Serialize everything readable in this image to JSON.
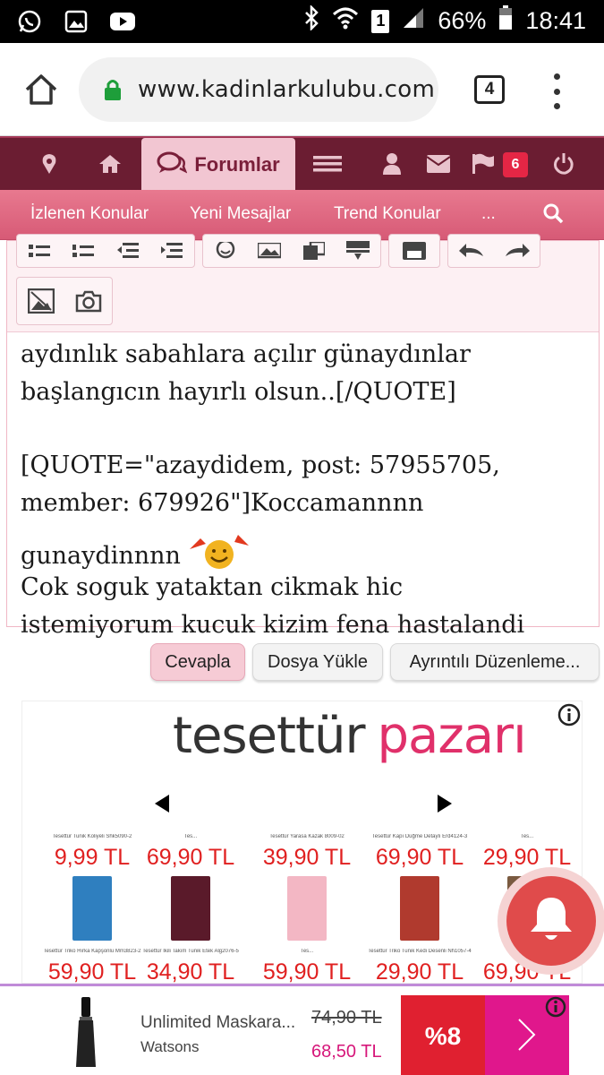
{
  "status_bar": {
    "battery": "66%",
    "time": "18:41",
    "sim": "1",
    "icons": [
      "whatsapp-icon",
      "gallery-icon",
      "youtube-icon",
      "bluetooth-icon",
      "wifi-icon",
      "signal-icon",
      "battery-icon"
    ]
  },
  "browser": {
    "url": "www.kadinlarkulubu.com",
    "tab_count": "4"
  },
  "site_nav": {
    "active_label": "Forumlar",
    "badge_count": "6",
    "icons": [
      "location-pin-icon",
      "home-icon",
      "forum-chat-icon",
      "hamburger-menu-icon",
      "user-icon",
      "envelope-icon",
      "flag-icon",
      "power-icon"
    ]
  },
  "sub_nav": {
    "items": [
      "İzlenen Konular",
      "Yeni Mesajlar",
      "Trend Konular",
      "..."
    ]
  },
  "editor": {
    "lines": [
      "aydınlık sabahlara açılır günaydınlar",
      "başlangıcın hayırlı olsun..[/QUOTE]",
      "[QUOTE=\"azaydidem, post: 57955705,",
      "member: 679926\"]Koccamannnn",
      "gunaydinnnn",
      "Cok soguk yataktan cikmak hic",
      "istemiyorum kucuk kizim fena hastalandi"
    ]
  },
  "actions": {
    "reply": "Cevapla",
    "upload": "Dosya Yükle",
    "advanced": "Ayrıntılı Düzenleme..."
  },
  "ad": {
    "logo_part1": "tesettür",
    "logo_part2": "pazarı",
    "row1": [
      {
        "name": "Tesettür Tunik Koliyeli Shk5090-2",
        "price": "9,99 TL",
        "img_color": "#e8e8e8"
      },
      {
        "name": "Tes...",
        "price": "69,90 TL",
        "img_color": "#e8e8e8"
      },
      {
        "name": "Tesettür Yarasa Kazak 8009-02",
        "price": "39,90 TL",
        "img_color": "#e8e8e8"
      },
      {
        "name": "Tesettür Kapı Düğme Detaylı Erd4124-3",
        "price": "69,90 TL",
        "img_color": "#e8e8e8"
      },
      {
        "name": "Tes...",
        "price": "29,90 TL",
        "img_color": "#e8e8e8"
      }
    ],
    "row2": [
      {
        "name": "Tesettür Triko Hırka Kapşonlu Mm3823-2",
        "price": "59,90 TL",
        "img_color": "#2f7fbf"
      },
      {
        "name": "Tesettür İkili Takım Tunik Etek Alg2076-5",
        "price": "34,90 TL",
        "img_color": "#5a1a2a"
      },
      {
        "name": "Tes...",
        "price": "59,90 TL",
        "img_color": "#f3b7c4"
      },
      {
        "name": "Tesettür Triko Tunik Kedi Desenli Nh1057-4",
        "price": "29,90 TL",
        "img_color": "#b03a2e"
      },
      {
        "name": "",
        "price": "69,90 TL",
        "img_color": "#7a5a40"
      }
    ]
  },
  "banner": {
    "product_name": "Unlimited Maskara...",
    "brand": "Watsons",
    "old_price": "74,90 TL",
    "new_price": "68,50 TL",
    "discount": "%8"
  }
}
